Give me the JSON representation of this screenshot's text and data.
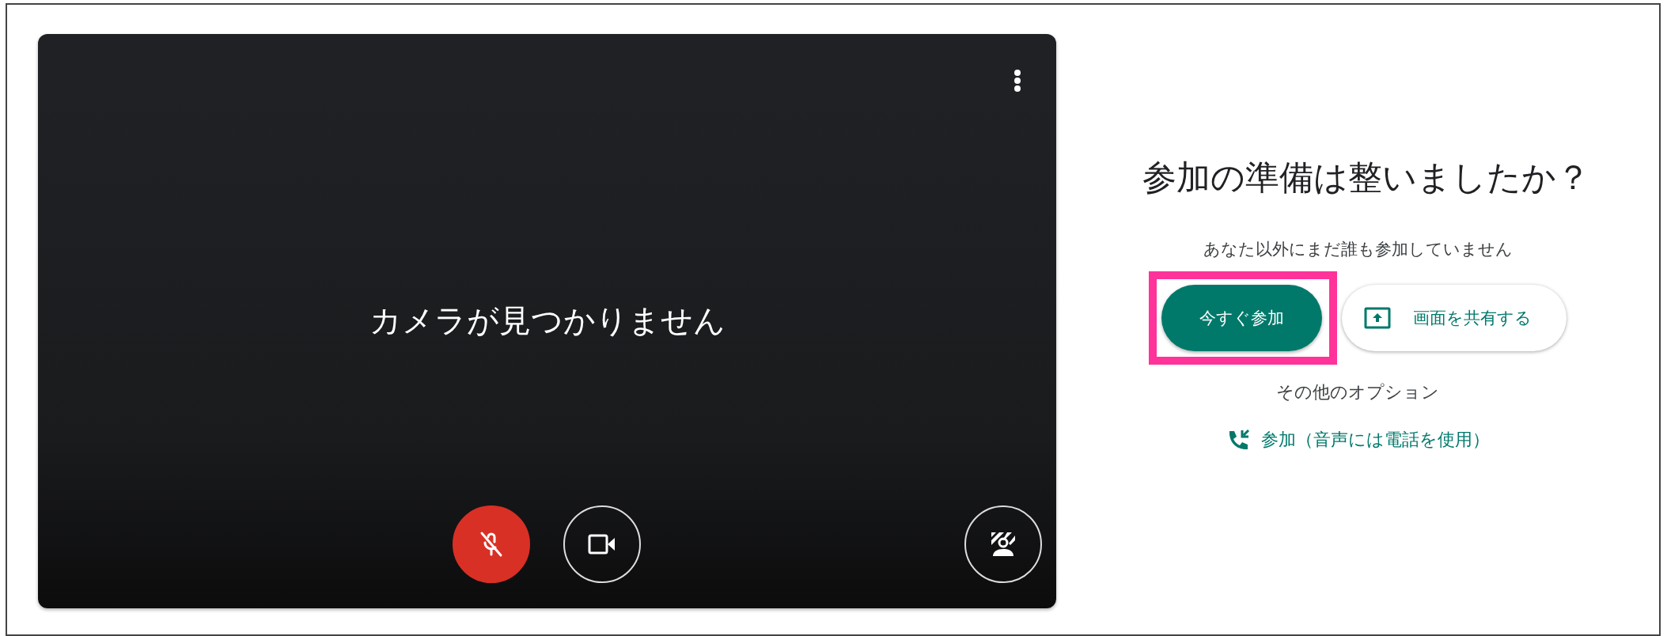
{
  "preview": {
    "message": "カメラが見つかりません",
    "controls": [
      {
        "kind": "mic",
        "muted": true
      },
      {
        "kind": "camera",
        "muted": false
      },
      {
        "kind": "effects",
        "muted": false
      }
    ]
  },
  "join_panel": {
    "title": "参加の準備は整いましたか？",
    "subtitle": "あなた以外にまだ誰も参加していません",
    "buttons": [
      {
        "kind": "primary",
        "label": "今すぐ参加",
        "highlighted": true
      },
      {
        "kind": "share",
        "label": "画面を共有する",
        "highlighted": false
      }
    ],
    "options_label": "その他のオプション",
    "phone_link": "参加（音声には電話を使用）"
  }
}
